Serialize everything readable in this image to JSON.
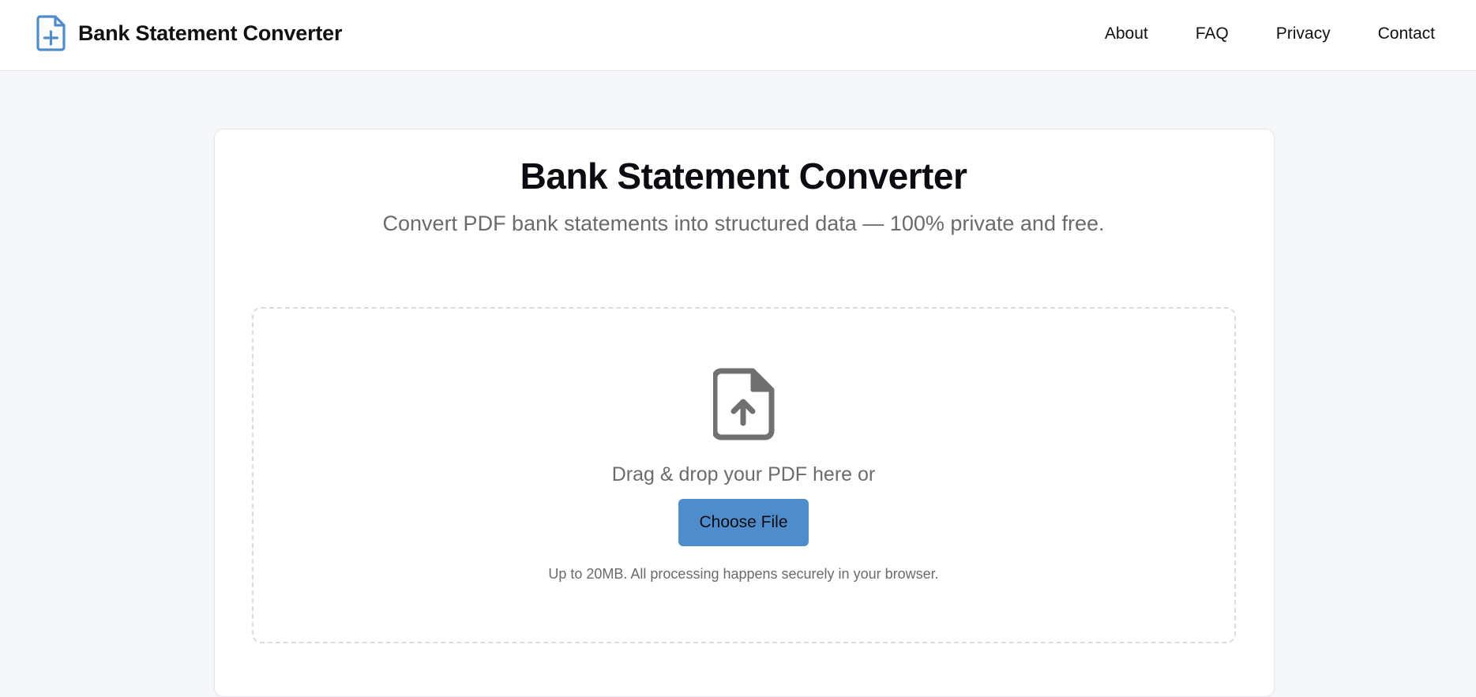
{
  "header": {
    "brand_title": "Bank Statement Converter",
    "nav": [
      "About",
      "FAQ",
      "Privacy",
      "Contact"
    ]
  },
  "main": {
    "title": "Bank Statement Converter",
    "subtitle": "Convert PDF bank statements into structured data — 100% private and free."
  },
  "upload": {
    "drop_text": "Drag & drop your PDF here or",
    "button_label": "Choose File",
    "note": "Up to 20MB. All processing happens securely in your browser."
  },
  "icons": {
    "brand": "document-plus-icon",
    "upload": "file-upload-icon"
  },
  "colors": {
    "accent": "#4f8ccc",
    "background": "#f6f7f9",
    "muted_text": "#6b6b6b",
    "icon_gray": "#707070"
  }
}
